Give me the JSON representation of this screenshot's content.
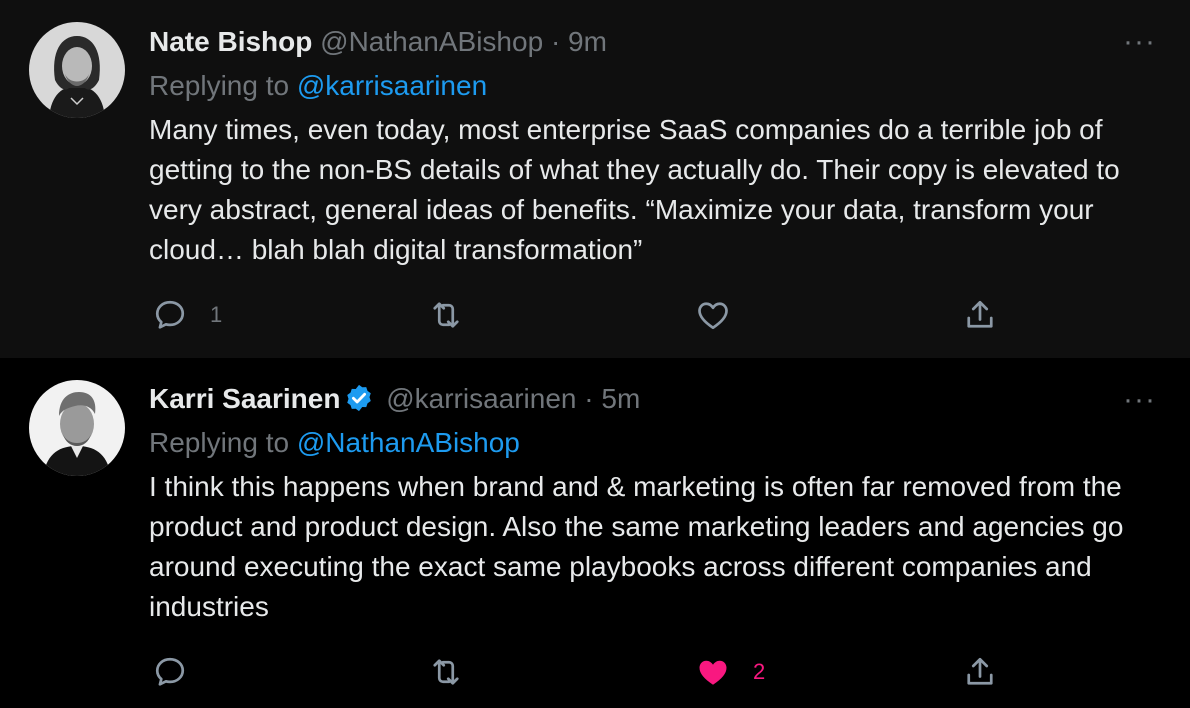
{
  "tweets": [
    {
      "name": "Nate Bishop",
      "handle": "@NathanABishop",
      "separator": "·",
      "time": "9m",
      "replying_prefix": "Replying to",
      "replying_to": "@karrisaarinen",
      "text": "Many times, even today, most enterprise SaaS companies do a terrible job of getting to the non-BS details of what they actually do. Their copy is elevated to very abstract, general ideas of benefits. “Maximize your data, transform your cloud… blah blah digital transformation”",
      "more": "···",
      "reply_count": "1",
      "retweet_count": "",
      "like_count": "",
      "liked": false
    },
    {
      "name": "Karri Saarinen",
      "verified": true,
      "handle": "@karrisaarinen",
      "separator": "·",
      "time": "5m",
      "replying_prefix": "Replying to",
      "replying_to": "@NathanABishop",
      "text": "I think this happens when brand and & marketing is often far removed from the product and product design. Also the same marketing leaders and agencies go around executing the exact same playbooks across different companies and industries",
      "more": "···",
      "reply_count": "",
      "retweet_count": "",
      "like_count": "2",
      "liked": true
    }
  ],
  "colors": {
    "background_top": "#0f0f0f",
    "background_bottom": "#000000",
    "text": "#e7e9ea",
    "muted": "#71767b",
    "link": "#1d9bf0",
    "like": "#f91880",
    "verified": "#1d9bf0"
  },
  "icons": {
    "reply": "reply-icon",
    "retweet": "retweet-icon",
    "like": "heart-icon",
    "share": "share-icon",
    "verified": "verified-badge-icon",
    "more": "more-icon"
  }
}
